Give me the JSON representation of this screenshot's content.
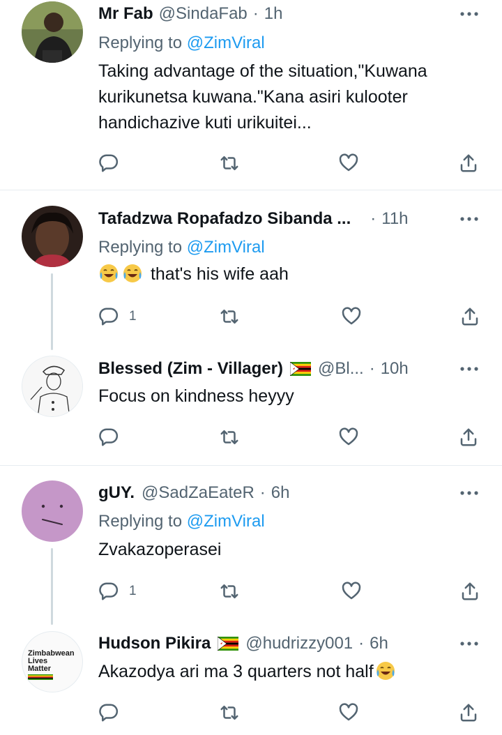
{
  "tweets": [
    {
      "name": "Mr Fab",
      "handle": "@SindaFab",
      "time": "1h",
      "replying_label": "Replying to",
      "replying_to": "@ZimViral",
      "text": "Taking advantage of the situation,\"Kuwana kurikunetsa kuwana.\"Kana asiri kulooter handichazive kuti urikuitei...",
      "reply_count": "",
      "avatar_icon": "profile-photo"
    },
    {
      "name": "Tafadzwa Ropafadzo Sibanda ...",
      "handle": "",
      "time": "11h",
      "replying_label": "Replying to",
      "replying_to": "@ZimViral",
      "text": "that's his wife aah",
      "emojis": [
        "face-with-tears-of-joy",
        "face-with-tears-of-joy"
      ],
      "reply_count": "1",
      "avatar_icon": "profile-photo"
    },
    {
      "name": "Blessed (Zim - Villager)",
      "flag": "zimbabwe-flag",
      "handle": "@Bl...",
      "time": "10h",
      "text": "Focus on kindness heyyy",
      "reply_count": "",
      "avatar_icon": "soldier-sketch"
    },
    {
      "name": "gUY.",
      "handle": "@SadZaEateR",
      "time": "6h",
      "replying_label": "Replying to",
      "replying_to": "@ZimViral",
      "text": "Zvakazoperasei",
      "reply_count": "1",
      "avatar_icon": "neutral-face"
    },
    {
      "name": "Hudson Pikira",
      "flag": "zimbabwe-flag",
      "handle": "@hudrizzy001",
      "time": "6h",
      "text": "Akazodya ari ma 3 quarters not half",
      "emojis_after": [
        "face-with-tears-of-joy"
      ],
      "reply_count": "",
      "avatar_lines": [
        "Zimbabwean",
        "Lives",
        "Matter"
      ]
    }
  ],
  "dot": "·",
  "colors": {
    "text": "#0f1419",
    "secondary": "#536471",
    "link": "#1d9bf0",
    "divider": "#e6ecf0",
    "thread": "#cfd9de"
  }
}
